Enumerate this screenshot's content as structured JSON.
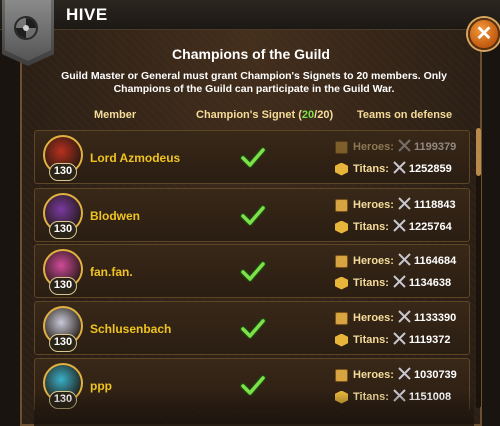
{
  "header": {
    "guild_name": "HIVE"
  },
  "panel": {
    "title": "Champions of the Guild",
    "description": "Guild Master or General must grant Champion's Signets to 20 members. Only Champions of the Guild can participate in the Guild War.",
    "close_label": "✕"
  },
  "columns": {
    "member": "Member",
    "signet_prefix": "Champion's Signet",
    "signet_open": "(",
    "signet_count": "20",
    "signet_total": "/20)",
    "teams": "Teams on defense"
  },
  "labels": {
    "heroes": "Heroes:",
    "titans": "Titans:"
  },
  "members": [
    {
      "name": "Lord Azmodeus",
      "level": "130",
      "heroes": "1199379",
      "titans": "1252859",
      "avatar_color": "#b8301e",
      "heroes_dim": true
    },
    {
      "name": "Blodwen",
      "level": "130",
      "heroes": "1118843",
      "titans": "1225764",
      "avatar_color": "#7a3aa0",
      "heroes_dim": false
    },
    {
      "name": "fan.fan.",
      "level": "130",
      "heroes": "1164684",
      "titans": "1134638",
      "avatar_color": "#d04a9a",
      "heroes_dim": false
    },
    {
      "name": "Schlusenbach",
      "level": "130",
      "heroes": "1133390",
      "titans": "1119372",
      "avatar_color": "#c8c8d8",
      "heroes_dim": false
    },
    {
      "name": "ppp",
      "level": "130",
      "heroes": "1030739",
      "titans": "1151008",
      "avatar_color": "#3ab0c8",
      "heroes_dim": false
    }
  ],
  "colors": {
    "accent_gold": "#f0c420",
    "check_green": "#7ee04a",
    "panel_bg": "#2b1f15"
  },
  "icons": {
    "banner": "guild-emblem-icon",
    "check": "checkmark-icon",
    "heroes": "hero-team-icon",
    "titans": "titan-team-icon",
    "power": "crossed-swords-icon",
    "close": "close-icon"
  }
}
